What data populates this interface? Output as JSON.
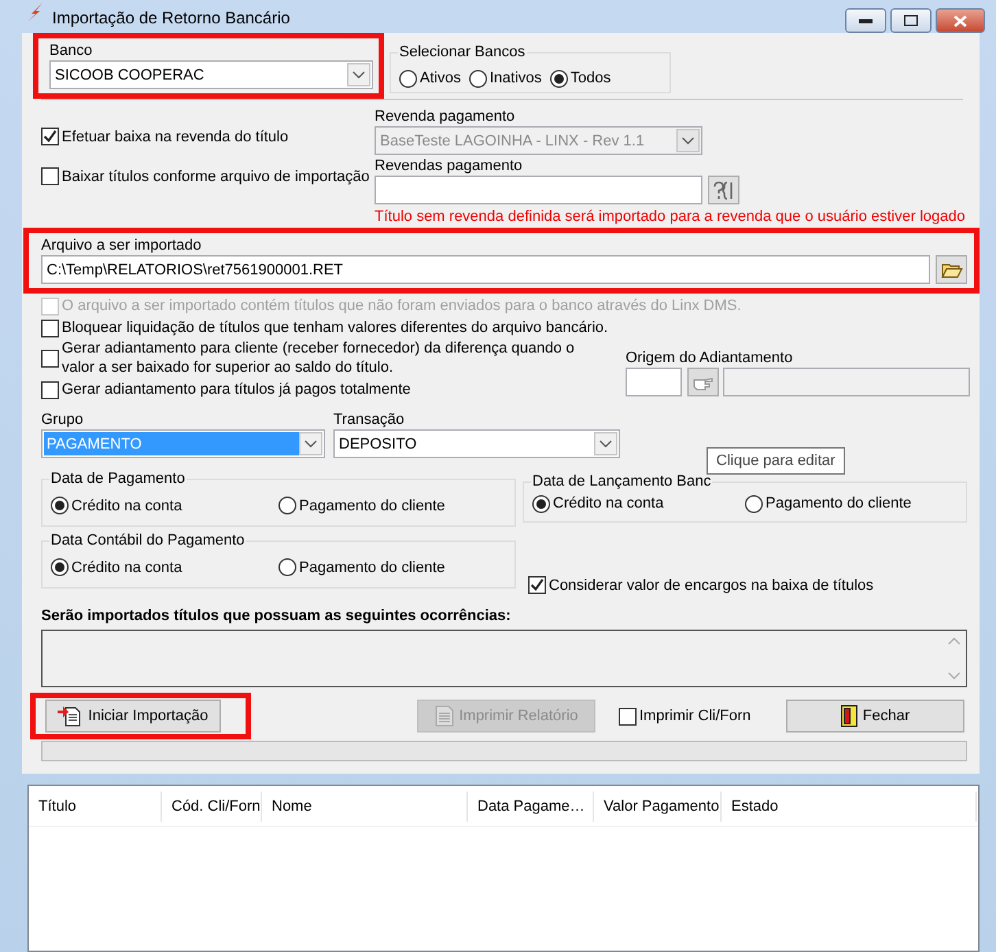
{
  "window": {
    "title": "Importação de Retorno Bancário"
  },
  "banco": {
    "label": "Banco",
    "value": "SICOOB COOPERAC",
    "annotated": true
  },
  "selecionar_bancos": {
    "label": "Selecionar Bancos",
    "options": [
      {
        "label": "Ativos",
        "selected": false
      },
      {
        "label": "Inativos",
        "selected": false
      },
      {
        "label": "Todos",
        "selected": true
      }
    ]
  },
  "efetuar_baixa": {
    "label": "Efetuar baixa na revenda do título",
    "checked": true
  },
  "revenda_pagamento": {
    "label": "Revenda pagamento",
    "value": "BaseTeste LAGOINHA - LINX - Rev 1.1",
    "disabled": true
  },
  "baixar_titulos": {
    "label": "Baixar títulos conforme arquivo de importação",
    "checked": false
  },
  "revendas_pagamento": {
    "label": "Revendas pagamento"
  },
  "warning": "Título sem revenda definida será importado para a revenda que o usuário estiver logado",
  "arquivo": {
    "label": "Arquivo a ser importado",
    "value": "C:\\Temp\\RELATORIOS\\ret7561900001.RET",
    "annotated": true
  },
  "options": [
    {
      "label": "O arquivo a ser importado contém títulos que não foram enviados para o banco através do Linx DMS.",
      "checked": false,
      "disabled": true
    },
    {
      "label": "Bloquear liquidação de títulos que tenham valores diferentes do arquivo bancário.",
      "checked": false,
      "disabled": false
    },
    {
      "label": "Gerar adiantamento para cliente (receber fornecedor) da diferença quando o valor a ser baixado for superior ao saldo do título.",
      "checked": false,
      "disabled": false
    },
    {
      "label": "Gerar adiantamento para títulos já pagos totalmente",
      "checked": false,
      "disabled": false
    }
  ],
  "origem_adiantamento": {
    "label": "Origem do Adiantamento"
  },
  "grupo": {
    "label": "Grupo",
    "value": "PAGAMENTO",
    "highlighted": true
  },
  "transacao": {
    "label": "Transação",
    "value": "DEPOSITO",
    "highlighted": false
  },
  "tooltip": "Clique para editar",
  "date_groups": [
    {
      "title": "Data de Pagamento",
      "options": [
        {
          "label": "Crédito na conta",
          "selected": true
        },
        {
          "label": "Pagamento do cliente",
          "selected": false
        }
      ]
    },
    {
      "title": "Data de Lançamento Banc",
      "options": [
        {
          "label": "Crédito na conta",
          "selected": true
        },
        {
          "label": "Pagamento do cliente",
          "selected": false
        }
      ]
    },
    {
      "title": "Data Contábil do Pagamento",
      "options": [
        {
          "label": "Crédito na conta",
          "selected": true
        },
        {
          "label": "Pagamento do cliente",
          "selected": false
        }
      ]
    }
  ],
  "considerar": {
    "label": "Considerar valor de encargos na baixa de títulos",
    "checked": true
  },
  "ocorrencias": {
    "label": "Serão importados títulos que possuam as seguintes ocorrências:"
  },
  "actions": [
    {
      "kind": "button",
      "label": "Iniciar Importação",
      "disabled": false,
      "annotated": true
    },
    {
      "kind": "button",
      "label": "Imprimir Relatório",
      "disabled": true,
      "annotated": false
    },
    {
      "kind": "checkbox",
      "label": "Imprimir Cli/Forn",
      "checked": false
    },
    {
      "kind": "button",
      "label": "Fechar",
      "disabled": false,
      "annotated": false
    }
  ],
  "progress": {
    "level": 0
  },
  "table": {
    "columns": [
      "Título",
      "Cód. Cli/Forn",
      "Nome",
      "Data Pagame…",
      "Valor Pagamento",
      "Estado"
    ]
  }
}
